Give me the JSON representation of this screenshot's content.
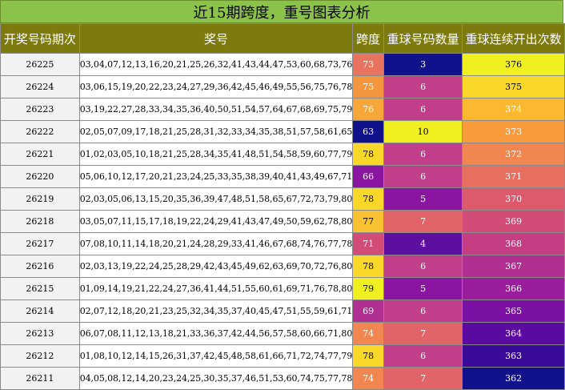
{
  "title": "近15期跨度，重号图表分析",
  "headers": {
    "period": "开奖号码期次",
    "numbers": "奖号",
    "span": "跨度",
    "repeat": "重球号码数量",
    "run": "重球连续开出次数"
  },
  "colors": {
    "title_bg": "#8bc34a",
    "header_bg": "#7d7a0e"
  },
  "rows": [
    {
      "period": "26225",
      "numbers": "03,04,07,12,13,16,20,21,25,26,32,41,43,44,47,53,60,68,73,76",
      "span": "73",
      "span_color": "#e8735e",
      "repeat": "3",
      "repeat_color": "#11118c",
      "run": "376",
      "run_color": "#f0f020"
    },
    {
      "period": "26224",
      "numbers": "03,06,15,19,20,22,23,24,27,29,36,42,45,46,49,55,56,75,76,78",
      "span": "75",
      "span_color": "#f4963e",
      "repeat": "6",
      "repeat_color": "#c13e8a",
      "run": "375",
      "run_color": "#fad82a"
    },
    {
      "period": "26223",
      "numbers": "03,19,22,27,28,33,34,35,36,40,50,51,54,57,64,67,68,69,75,79",
      "span": "76",
      "span_color": "#f7a63a",
      "repeat": "6",
      "repeat_color": "#c13e8a",
      "run": "374",
      "run_color": "#fbb932"
    },
    {
      "period": "26222",
      "numbers": "02,05,07,09,17,18,21,25,28,31,32,33,34,35,38,51,57,58,61,65",
      "span": "63",
      "span_color": "#11118c",
      "repeat": "10",
      "repeat_color": "#f0f020",
      "run": "373",
      "run_color": "#f99b3c"
    },
    {
      "period": "26221",
      "numbers": "01,02,03,05,10,18,21,25,28,34,35,41,48,51,54,58,59,60,77,79",
      "span": "78",
      "span_color": "#fad82a",
      "repeat": "6",
      "repeat_color": "#c13e8a",
      "run": "372",
      "run_color": "#f28650"
    },
    {
      "period": "26220",
      "numbers": "05,06,10,12,17,20,21,23,24,25,33,35,38,39,40,41,43,49,67,71",
      "span": "66",
      "span_color": "#8a15a0",
      "repeat": "6",
      "repeat_color": "#c13e8a",
      "run": "371",
      "run_color": "#e87060"
    },
    {
      "period": "26219",
      "numbers": "02,03,05,06,13,15,20,35,36,39,47,48,51,58,65,67,72,73,79,80",
      "span": "78",
      "span_color": "#fad82a",
      "repeat": "5",
      "repeat_color": "#8a15a0",
      "run": "370",
      "run_color": "#dc5a6c"
    },
    {
      "period": "26218",
      "numbers": "03,05,07,11,15,17,18,19,22,24,29,41,43,47,49,50,59,62,78,80",
      "span": "77",
      "span_color": "#f9c233",
      "repeat": "7",
      "repeat_color": "#e06468",
      "run": "369",
      "run_color": "#d24c78"
    },
    {
      "period": "26217",
      "numbers": "07,08,10,11,14,18,20,21,24,28,29,33,41,46,67,68,74,76,77,78",
      "span": "71",
      "span_color": "#d24c78",
      "repeat": "4",
      "repeat_color": "#5d0fa0",
      "run": "368",
      "run_color": "#c53e84"
    },
    {
      "period": "26216",
      "numbers": "02,03,13,19,22,24,25,28,29,42,43,45,49,62,63,69,70,72,76,80",
      "span": "78",
      "span_color": "#fad82a",
      "repeat": "6",
      "repeat_color": "#c13e8a",
      "run": "367",
      "run_color": "#b02f90"
    },
    {
      "period": "26215",
      "numbers": "01,09,14,19,21,22,24,27,36,41,44,51,55,60,61,69,71,76,78,80",
      "span": "79",
      "span_color": "#f0f020",
      "repeat": "5",
      "repeat_color": "#8a15a0",
      "run": "366",
      "run_color": "#9a1e9c"
    },
    {
      "period": "26214",
      "numbers": "02,07,12,18,20,21,23,25,32,34,35,37,40,45,47,51,55,59,61,71",
      "span": "69",
      "span_color": "#b02f90",
      "repeat": "6",
      "repeat_color": "#c13e8a",
      "run": "365",
      "run_color": "#7a10a4"
    },
    {
      "period": "26213",
      "numbers": "06,07,08,11,12,13,18,21,33,36,37,42,44,56,57,58,60,66,71,80",
      "span": "74",
      "span_color": "#f28650",
      "repeat": "7",
      "repeat_color": "#e06468",
      "run": "364",
      "run_color": "#5a0aa0"
    },
    {
      "period": "26212",
      "numbers": "01,08,10,12,14,15,26,31,37,42,45,48,58,61,66,71,72,74,77,79",
      "span": "78",
      "span_color": "#fad82a",
      "repeat": "6",
      "repeat_color": "#c13e8a",
      "run": "363",
      "run_color": "#3a0a98"
    },
    {
      "period": "26211",
      "numbers": "04,05,08,12,14,20,23,24,25,30,35,37,46,51,53,60,74,75,77,78",
      "span": "74",
      "span_color": "#f28650",
      "repeat": "7",
      "repeat_color": "#e06468",
      "run": "362",
      "run_color": "#11118c"
    }
  ]
}
